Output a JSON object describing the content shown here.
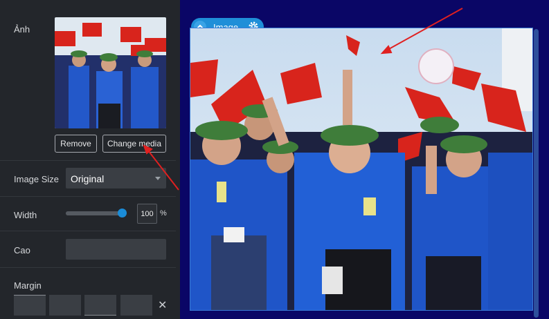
{
  "panel": {
    "image_label": "Ảnh",
    "remove_label": "Remove",
    "change_media_label": "Change media",
    "image_size_label": "Image Size",
    "image_size_value": "Original",
    "width_label": "Width",
    "width_value": "100",
    "width_unit": "%",
    "width_fraction": 1.0,
    "cao_label": "Cao",
    "margin_label": "Margin",
    "clear_symbol": "✕"
  },
  "element_tab": {
    "label": "Image",
    "icons": [
      "chevron-up-icon",
      "gear-icon"
    ]
  },
  "colors": {
    "accent": "#1f8fd8",
    "panel_bg": "#23262b",
    "canvas_bg": "#0a0666",
    "annotation_arrow": "#e02020"
  }
}
